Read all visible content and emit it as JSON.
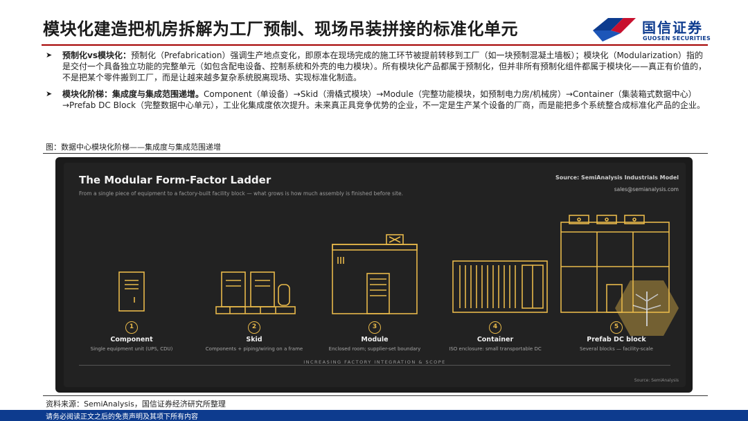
{
  "header": {
    "title": "模块化建造把机房拆解为工厂预制、现场吊装拼接的标准化单元",
    "logo_cn": "国信证券",
    "logo_en": "GUOSEN SECURITIES"
  },
  "bullets": [
    {
      "lead": "预制化vs模块化：",
      "text": "预制化（Prefabrication）强调生产地点变化，即原本在现场完成的施工环节被提前转移到工厂（如一块预制混凝土墙板）；模块化（Modularization）指的是交付一个具备独立功能的完整单元（如包含配电设备、控制系统和外壳的电力模块）。所有模块化产品都属于预制化，但并非所有预制化组件都属于模块化——真正有价值的，不是把某个零件搬到工厂，而是让越来越多复杂系统脱离现场、实现标准化制造。"
    },
    {
      "lead": "模块化阶梯：集成度与集成范围递增。",
      "text": "Component（单设备）→Skid（滑橇式模块）→Module（完整功能模块，如预制电力房/机械房）→Container（集装箱式数据中心）→Prefab DC Block（完整数据中心单元），工业化集成度依次提升。未来真正具竞争优势的企业，不一定是生产某个设备的厂商，而是能把多个系统整合成标准化产品的企业。"
    }
  ],
  "figure": {
    "caption": "图：数据中心模块化阶梯——集成度与集成范围递增",
    "title": "The Modular Form-Factor Ladder",
    "subtitle": "From a single piece of equipment to a factory-built facility block — what grows is how much assembly is finished before site.",
    "source": "Source: SemiAnalysis Industrials Model",
    "email": "sales@semianalysis.com",
    "axis_label": "INCREASING FACTORY INTEGRATION & SCOPE",
    "corner_source": "Source: SemiAnalysis",
    "stages": [
      {
        "num": "1",
        "name": "Component",
        "desc": "Single equipment unit (UPS, CDU)"
      },
      {
        "num": "2",
        "name": "Skid",
        "desc": "Components + piping/wiring on a frame"
      },
      {
        "num": "3",
        "name": "Module",
        "desc": "Enclosed room; supplier-set boundary"
      },
      {
        "num": "4",
        "name": "Container",
        "desc": "ISO enclosure: small transportable DC"
      },
      {
        "num": "5",
        "name": "Prefab DC block",
        "desc": "Several blocks — facility-scale"
      }
    ]
  },
  "footer": {
    "source": "资料来源：SemiAnalysis，国信证券经济研究所整理",
    "disclaimer": "请务必阅读正文之后的免责声明及其项下所有内容"
  },
  "colors": {
    "brand_blue": "#0d3b8e",
    "brand_red": "#c8102e",
    "accent_gold": "#e8b94a",
    "panel_bg": "#222222"
  }
}
